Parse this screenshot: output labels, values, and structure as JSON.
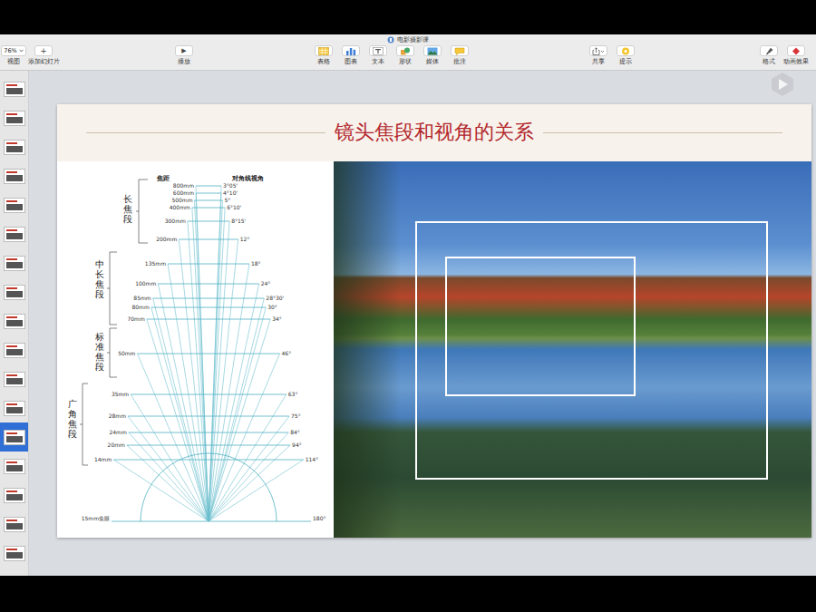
{
  "window": {
    "title": "电影摄影课"
  },
  "toolbar": {
    "left": [
      {
        "label": "视图",
        "kind": "zoom",
        "value": "76%"
      },
      {
        "label": "添加幻灯片",
        "kind": "add",
        "glyph": "+"
      }
    ],
    "play": {
      "label": "播放",
      "kind": "play",
      "glyph": "▶"
    },
    "insert": [
      {
        "label": "表格",
        "kind": "table"
      },
      {
        "label": "图表",
        "kind": "chart"
      },
      {
        "label": "文本",
        "kind": "text"
      },
      {
        "label": "形状",
        "kind": "shape"
      },
      {
        "label": "媒体",
        "kind": "media"
      },
      {
        "label": "批注",
        "kind": "comment"
      }
    ],
    "share": [
      {
        "label": "共享",
        "kind": "share"
      },
      {
        "label": "提示",
        "kind": "tips"
      }
    ],
    "inspector": [
      {
        "label": "格式",
        "kind": "format"
      },
      {
        "label": "动画效果",
        "kind": "animate"
      }
    ]
  },
  "thumbnails": [
    {
      "selected": false
    },
    {
      "selected": false
    },
    {
      "selected": false
    },
    {
      "selected": false
    },
    {
      "selected": false
    },
    {
      "selected": false
    },
    {
      "selected": false
    },
    {
      "selected": false
    },
    {
      "selected": false
    },
    {
      "selected": false
    },
    {
      "selected": false
    },
    {
      "selected": false
    },
    {
      "selected": true
    },
    {
      "selected": false
    },
    {
      "selected": false
    },
    {
      "selected": false
    },
    {
      "selected": false
    }
  ],
  "slide": {
    "title": "镜头焦段和视角的关系",
    "diagram": {
      "headers": {
        "focal": "焦距",
        "angle": "对角线视角"
      },
      "groups": [
        "长焦段",
        "中长焦段",
        "标准焦段",
        "广角焦段"
      ],
      "lenses": [
        {
          "focal": "800mm",
          "angle": "3°05'",
          "kind": "line"
        },
        {
          "focal": "600mm",
          "angle": "4°10'",
          "kind": "line"
        },
        {
          "focal": "500mm",
          "angle": "5°",
          "kind": "line"
        },
        {
          "focal": "400mm",
          "angle": "6°10'",
          "kind": "line"
        },
        {
          "focal": "300mm",
          "angle": "8°15'",
          "kind": "line"
        },
        {
          "focal": "200mm",
          "angle": "12°",
          "kind": "line"
        },
        {
          "focal": "135mm",
          "angle": "18°",
          "kind": "line"
        },
        {
          "focal": "100mm",
          "angle": "24°",
          "kind": "line"
        },
        {
          "focal": "85mm",
          "angle": "28°30'",
          "kind": "line"
        },
        {
          "focal": "80mm",
          "angle": "30°",
          "kind": "line"
        },
        {
          "focal": "70mm",
          "angle": "34°",
          "kind": "line"
        },
        {
          "focal": "50mm",
          "angle": "46°",
          "kind": "line"
        },
        {
          "focal": "35mm",
          "angle": "63°",
          "kind": "line"
        },
        {
          "focal": "28mm",
          "angle": "75°",
          "kind": "line"
        },
        {
          "focal": "24mm",
          "angle": "84°",
          "kind": "line"
        },
        {
          "focal": "20mm",
          "angle": "94°",
          "kind": "line"
        },
        {
          "focal": "14mm",
          "angle": "114°",
          "kind": "line"
        },
        {
          "focal": "15mm鱼眼",
          "angle": "180°",
          "kind": "fisheye"
        }
      ]
    }
  }
}
